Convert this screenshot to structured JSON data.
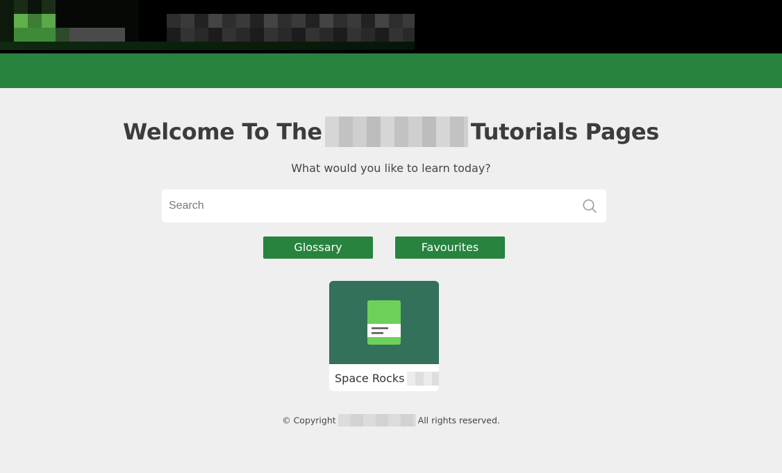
{
  "header": {
    "logo_icon": "site-logo-icon",
    "colors": {
      "topbar": "#000000",
      "navbar": "#27833e"
    }
  },
  "hero": {
    "title_before": "Welcome To The",
    "title_after": "Tutorials Pages",
    "subtitle": "What would you like to learn today?"
  },
  "search": {
    "placeholder": "Search",
    "value": "",
    "icon": "search-icon"
  },
  "buttons": {
    "glossary": "Glossary",
    "favourites": "Favourites"
  },
  "cards": [
    {
      "title": "Space Rocks",
      "icon": "book-icon",
      "thumb_color": "#33715b",
      "icon_color": "#6dd05a"
    }
  ],
  "footer": {
    "copyright_prefix": "© Copyright",
    "copyright_suffix": "All rights reserved."
  }
}
